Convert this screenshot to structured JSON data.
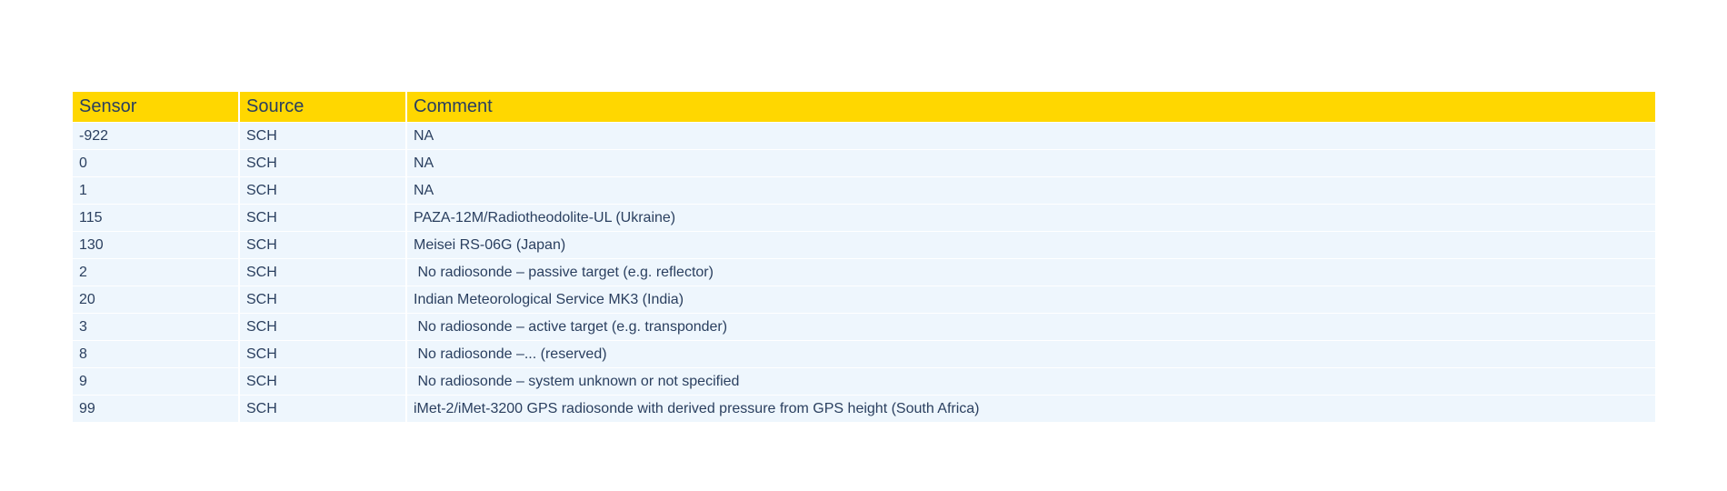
{
  "chart_data": {
    "type": "table",
    "columns": [
      "Sensor",
      "Source",
      "Comment"
    ],
    "rows": [
      [
        "-922",
        "SCH",
        "NA"
      ],
      [
        "0",
        "SCH",
        "NA"
      ],
      [
        "1",
        "SCH",
        "NA"
      ],
      [
        "115",
        "SCH",
        "PAZA-12M/Radiotheodolite-UL (Ukraine)"
      ],
      [
        "130",
        "SCH",
        "Meisei RS-06G (Japan)"
      ],
      [
        "2",
        "SCH",
        " No radiosonde – passive target (e.g. reflector)"
      ],
      [
        "20",
        "SCH",
        "Indian Meteorological Service MK3 (India)"
      ],
      [
        "3",
        "SCH",
        " No radiosonde – active target (e.g. transponder)"
      ],
      [
        "8",
        "SCH",
        " No radiosonde –... (reserved)"
      ],
      [
        "9",
        "SCH",
        " No radiosonde – system unknown or not specified"
      ],
      [
        "99",
        "SCH",
        "iMet-2/iMet-3200 GPS radiosonde with derived pressure from GPS height (South Africa)"
      ]
    ],
    "colors": {
      "header_fill": "#ffd700",
      "cell_fill": "#eef6fd",
      "text": "#2a3f5f"
    }
  }
}
